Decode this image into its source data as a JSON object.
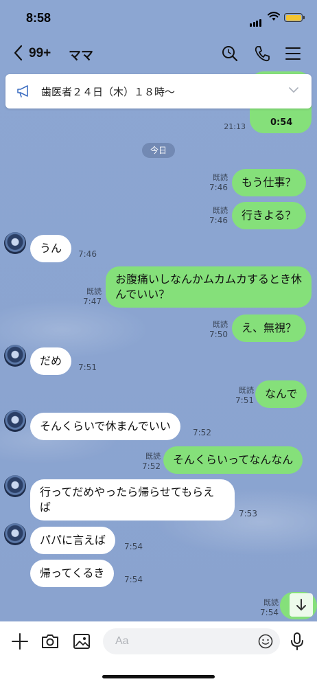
{
  "status_bar": {
    "time": "8:58"
  },
  "header": {
    "back_count": "99+",
    "title": "ママ"
  },
  "announcement": {
    "text": "歯医者２４日（木）１８時〜"
  },
  "previous": {
    "duration": "0:54",
    "time": "21:13"
  },
  "day_label": "今日",
  "read_label": "既読",
  "messages": [
    {
      "side": "me",
      "text": "もう仕事？",
      "time": "7:46",
      "read": true
    },
    {
      "side": "me",
      "text": "行きよる？",
      "time": "7:46",
      "read": true
    },
    {
      "side": "them",
      "text": "うん",
      "time": "7:46"
    },
    {
      "side": "me",
      "text": "お腹痛いしなんかムカムカするとき休んでいい？",
      "time": "7:47",
      "read": true
    },
    {
      "side": "me",
      "text": "え、無視？",
      "time": "7:50",
      "read": true
    },
    {
      "side": "them",
      "text": "だめ",
      "time": "7:51"
    },
    {
      "side": "me",
      "text": "なんで",
      "time": "7:51",
      "read": true
    },
    {
      "side": "them",
      "text": "そんくらいで休まんでいい",
      "time": "7:52"
    },
    {
      "side": "me",
      "text": "そんくらいってなんなん",
      "time": "7:52",
      "read": true
    },
    {
      "side": "them",
      "text": "行ってだめやったら帰らせてもらえば",
      "time": "7:53"
    },
    {
      "side": "them",
      "text": "パパに言えば",
      "time": "7:54"
    },
    {
      "side": "them",
      "text": "帰ってくるき",
      "time": "7:54"
    },
    {
      "side": "me",
      "text": "",
      "time": "7:54",
      "read": true
    }
  ],
  "input": {
    "placeholder": "Aa"
  },
  "icons": {
    "back": "chevron-left-icon",
    "search": "search-icon",
    "call": "phone-icon",
    "menu": "menu-icon",
    "megaphone": "megaphone-icon",
    "plus": "plus-icon",
    "camera": "camera-icon",
    "image": "image-icon",
    "emoji": "emoji-icon",
    "mic": "microphone-icon",
    "scroll": "arrow-down-icon"
  },
  "colors": {
    "background": "#8aa4cf",
    "my_bubble": "#85e07a",
    "their_bubble": "#ffffff",
    "battery": "#f4c431"
  }
}
